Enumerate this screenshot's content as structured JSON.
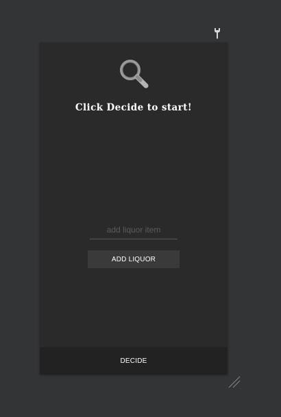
{
  "toolbar": {
    "settings_icon": "wrench-icon"
  },
  "main": {
    "header_icon": "magnifier-icon",
    "prompt": "Click Decide to start!",
    "input_placeholder": "add liquor item",
    "input_value": "",
    "add_button_label": "ADD LIQUOR",
    "decide_button_label": "DECIDE"
  },
  "window": {
    "resize_icon": "resize-grip-icon"
  },
  "colors": {
    "background": "#333436",
    "panel": "#2a2a2a",
    "button": "#3a3a3a",
    "decide_bar": "#222222",
    "text": "#ffffff"
  }
}
